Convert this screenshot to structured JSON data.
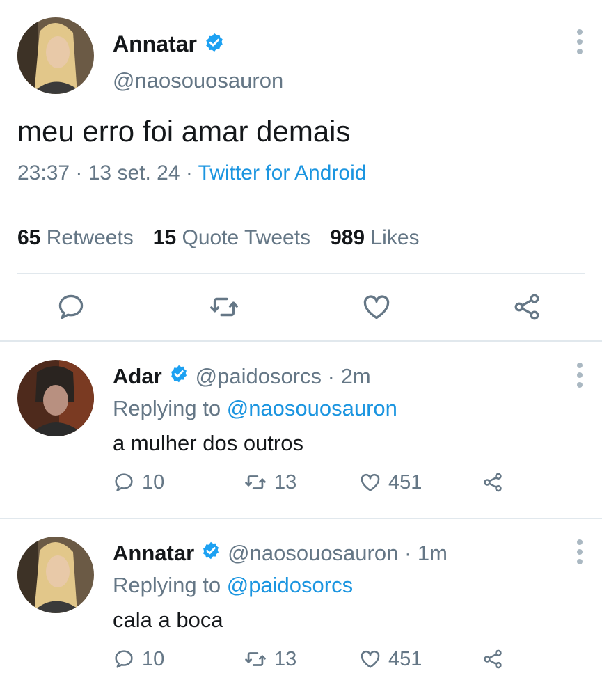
{
  "main_tweet": {
    "author_name": "Annatar",
    "author_handle": "@naosouosauron",
    "text": "meu erro foi amar demais",
    "time": "23:37",
    "date": "13 set. 24",
    "source": "Twitter for Android",
    "stats": {
      "retweets_count": "65",
      "retweets_label": "Retweets",
      "quotes_count": "15",
      "quotes_label": "Quote Tweets",
      "likes_count": "989",
      "likes_label": "Likes"
    },
    "actions": [
      "reply-icon",
      "retweet-icon",
      "like-icon",
      "share-icon"
    ]
  },
  "replies": [
    {
      "author_name": "Adar",
      "author_handle": "@paidosorcs",
      "time_ago": "2m",
      "replying_prefix": "Replying to",
      "replying_to": "@naosouosauron",
      "text": "a mulher dos outros",
      "reply_count": "10",
      "retweet_count": "13",
      "like_count": "451"
    },
    {
      "author_name": "Annatar",
      "author_handle": "@naosouosauron",
      "time_ago": "1m",
      "replying_prefix": "Replying to",
      "replying_to": "@paidosorcs",
      "text": "cala a boca",
      "reply_count": "10",
      "retweet_count": "13",
      "like_count": "451"
    }
  ],
  "colors": {
    "accent": "#1b95e0",
    "muted": "#657786",
    "verified": "#1da1f2",
    "divider": "#e1e8ed"
  }
}
